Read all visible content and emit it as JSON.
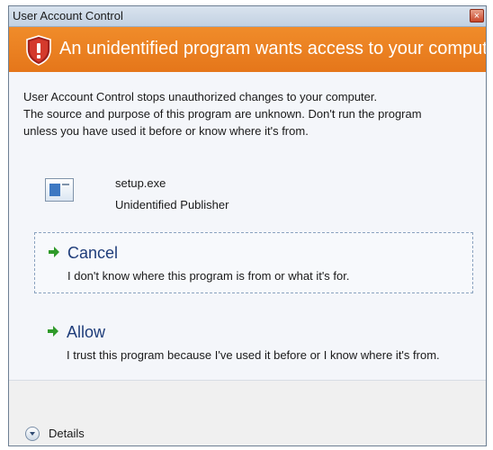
{
  "window": {
    "title": "User Account Control",
    "close_glyph": "×"
  },
  "banner": {
    "icon": "shield-icon",
    "text": "An unidentified program wants access to your computer",
    "color": "#e8801f"
  },
  "description": {
    "lines": [
      "User Account Control stops unauthorized changes to your computer.",
      "The source and purpose of this program are unknown.  Don't run the program",
      "unless you have used it before or know where it's from."
    ]
  },
  "program": {
    "icon": "program-window-icon",
    "name": "setup.exe",
    "publisher": "Unidentified Publisher"
  },
  "options": [
    {
      "icon": "green-arrow-icon",
      "title": "Cancel",
      "description": "I don't know where this program is from or what it's for."
    },
    {
      "icon": "green-arrow-icon",
      "title": "Allow",
      "description": "I trust this program because I've used it before or I know where it's from."
    }
  ],
  "footer": {
    "details_icon": "chevron-down-icon",
    "details_label": "Details"
  }
}
